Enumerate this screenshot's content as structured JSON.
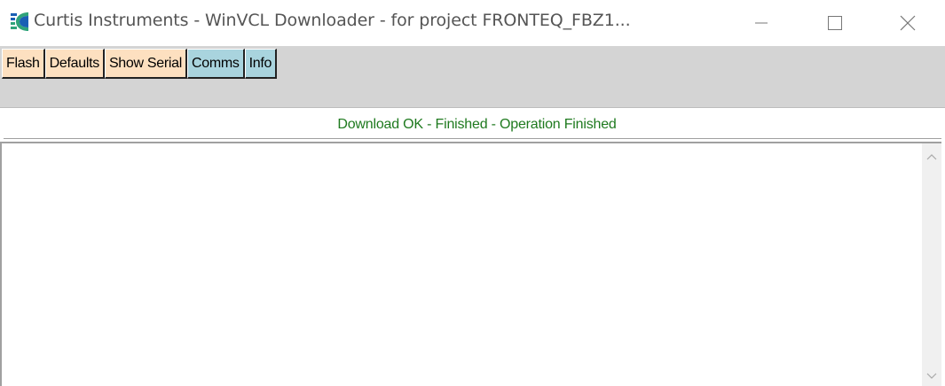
{
  "window": {
    "title": "Curtis Instruments - WinVCL Downloader - for project FRONTEQ_FBZ1...",
    "app_icon": "curtis-logo-icon"
  },
  "title_controls": {
    "minimize": "minimize-icon",
    "maximize": "maximize-icon",
    "close": "close-icon"
  },
  "toolbar": {
    "tabs": [
      {
        "label": "Flash",
        "color": "#fde0c0"
      },
      {
        "label": "Defaults",
        "color": "#fde0c0"
      },
      {
        "label": "Show Serial",
        "color": "#fde0c0"
      },
      {
        "label": "Comms",
        "color": "#a9d4de"
      },
      {
        "label": "Info",
        "color": "#a9d4de"
      }
    ]
  },
  "status": {
    "message": "Download OK - Finished - Operation Finished",
    "color": "#1f7a1f"
  },
  "output": {
    "text": ""
  },
  "scrollbar": {
    "up": "chevron-up-icon",
    "down": "chevron-down-icon"
  }
}
